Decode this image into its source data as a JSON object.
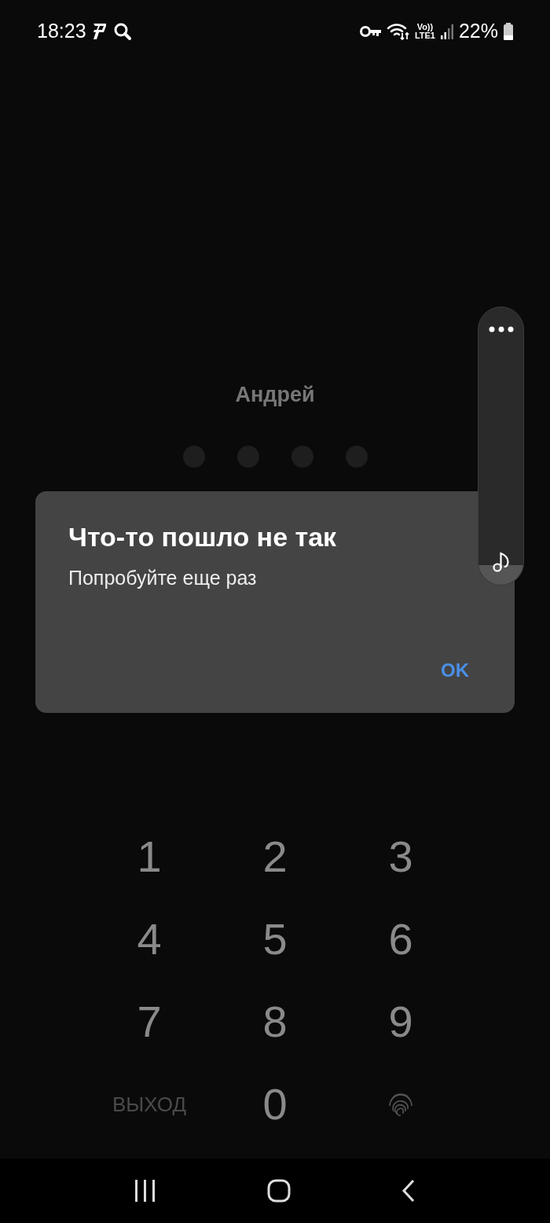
{
  "status_bar": {
    "time": "18:23",
    "network_label_top": "Vo))",
    "network_label_bottom": "LTE1",
    "battery": "22%"
  },
  "lock_screen": {
    "user_name": "Андрей",
    "pin_dots": [
      {
        "filled": false
      },
      {
        "filled": false
      },
      {
        "filled": false
      },
      {
        "filled": false
      }
    ]
  },
  "dialog": {
    "title": "Что-то пошло не так",
    "message": "Попробуйте еще раз",
    "button": "OK"
  },
  "volume_panel": {
    "level": 0.07
  },
  "keypad": [
    {
      "kind": "digit",
      "label": "1"
    },
    {
      "kind": "digit",
      "label": "2"
    },
    {
      "kind": "digit",
      "label": "3"
    },
    {
      "kind": "digit",
      "label": "4"
    },
    {
      "kind": "digit",
      "label": "5"
    },
    {
      "kind": "digit",
      "label": "6"
    },
    {
      "kind": "digit",
      "label": "7"
    },
    {
      "kind": "digit",
      "label": "8"
    },
    {
      "kind": "digit",
      "label": "9"
    },
    {
      "kind": "text",
      "label": "ВЫХОД"
    },
    {
      "kind": "digit",
      "label": "0"
    },
    {
      "kind": "fingerprint"
    }
  ]
}
